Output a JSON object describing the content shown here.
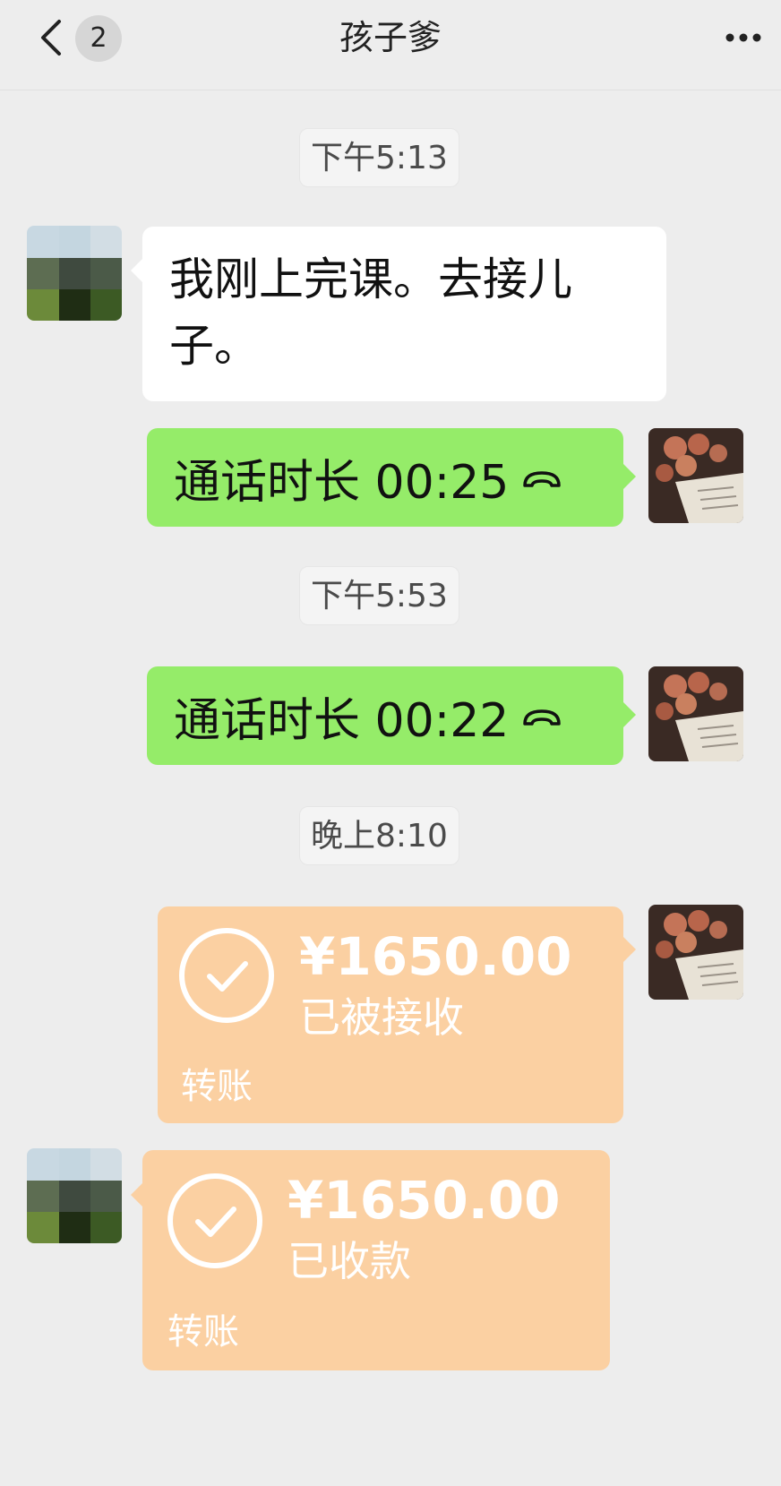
{
  "header": {
    "back_badge": "2",
    "title": "孩子爹",
    "icons": {
      "back": "chevron-left-icon",
      "more": "more-dots-icon"
    }
  },
  "messages": {
    "ts1": "下午5:13",
    "msg1": "我刚上完课。去接儿子。",
    "call1": "通话时长 00:25",
    "ts2": "下午5:53",
    "call2": "通话时长 00:22",
    "ts3": "晚上8:10",
    "transfer1": {
      "amount": "¥1650.00",
      "status": "已被接收",
      "label": "转账"
    },
    "transfer2": {
      "amount": "¥1650.00",
      "status": "已收款",
      "label": "转账"
    }
  },
  "colors": {
    "background": "#ededed",
    "sent_bubble": "#95ec69",
    "received_bubble": "#ffffff",
    "transfer_bubble": "#fbd0a2"
  }
}
